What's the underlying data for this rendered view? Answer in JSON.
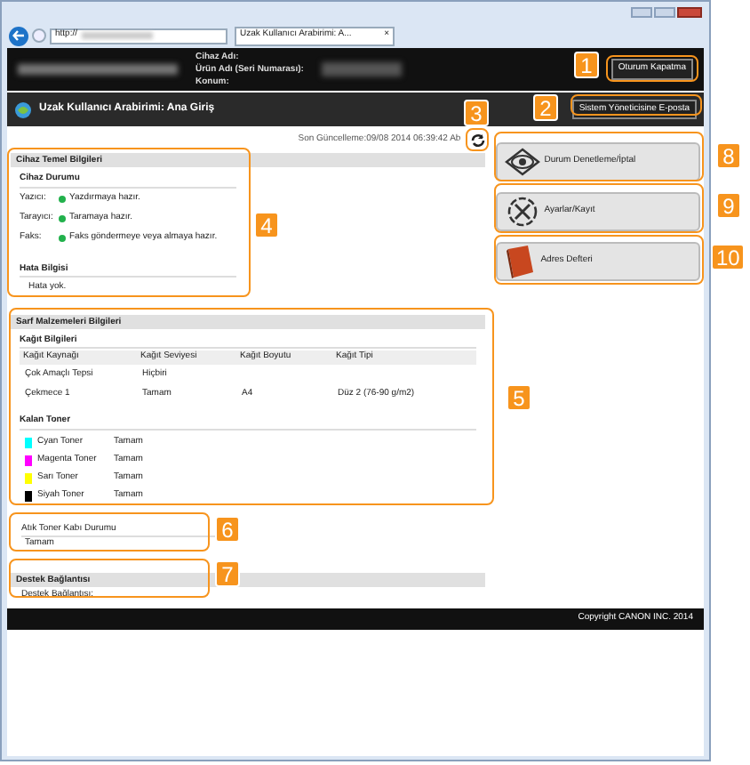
{
  "browser": {
    "address": "http://",
    "tab": "Uzak Kullanıcı Arabirimi: A...",
    "close": "×"
  },
  "header": {
    "fields": [
      "Cihaz Adı:",
      "Ürün Adı (Seri Numarası):",
      "Konum:"
    ],
    "logout": "Oturum Kapatma"
  },
  "title_bar": {
    "title": "Uzak Kullanıcı Arabirimi: Ana Giriş",
    "email_button": "Sistem Yöneticisine E-posta"
  },
  "last_updated": "Son Güncelleme:09/08 2014 06:39:42 Ab",
  "device_info": {
    "title": "Cihaz Temel Bilgileri",
    "status_title": "Cihaz Durumu",
    "rows": [
      {
        "label": "Yazıcı:",
        "status": "Yazdırmaya hazır.",
        "color": "#22b14c"
      },
      {
        "label": "Tarayıcı:",
        "status": "Taramaya hazır.",
        "color": "#22b14c"
      },
      {
        "label": "Faks:",
        "status": "Faks göndermeye veya almaya hazır.",
        "color": "#22b14c"
      }
    ],
    "error_title": "Hata Bilgisi",
    "error": "Hata yok."
  },
  "consumables": {
    "title": "Sarf Malzemeleri Bilgileri",
    "paper_title": "Kağıt Bilgileri",
    "columns": [
      "Kağıt Kaynağı",
      "Kağıt Seviyesi",
      "Kağıt Boyutu",
      "Kağıt Tipi"
    ],
    "rows": [
      [
        "Çok Amaçlı Tepsi",
        "Hiçbiri",
        "",
        ""
      ],
      [
        "Çekmece 1",
        "Tamam",
        "A4",
        "Düz 2 (76-90 g/m2)"
      ]
    ],
    "toner_title": "Kalan Toner",
    "toners": [
      {
        "name": "Cyan Toner",
        "status": "Tamam",
        "color": "#00ffff"
      },
      {
        "name": "Magenta Toner",
        "status": "Tamam",
        "color": "#ff00ff"
      },
      {
        "name": "Sarı Toner",
        "status": "Tamam",
        "color": "#ffff00"
      },
      {
        "name": "Siyah Toner",
        "status": "Tamam",
        "color": "#000000"
      }
    ]
  },
  "waste_toner": {
    "title": "Atık Toner Kabı Durumu",
    "value": "Tamam"
  },
  "support": {
    "title": "Destek Bağlantısı",
    "value": "Destek Bağlantısı:"
  },
  "menu": [
    {
      "label": "Durum Denetleme/İptal",
      "kind": "eye"
    },
    {
      "label": "Ayarlar/Kayıt",
      "kind": "settings"
    },
    {
      "label": "Adres Defteri",
      "kind": "book"
    }
  ],
  "footer": "Copyright CANON INC. 2014",
  "callouts": [
    "1",
    "2",
    "3",
    "4",
    "5",
    "6",
    "7",
    "8",
    "9",
    "10"
  ]
}
